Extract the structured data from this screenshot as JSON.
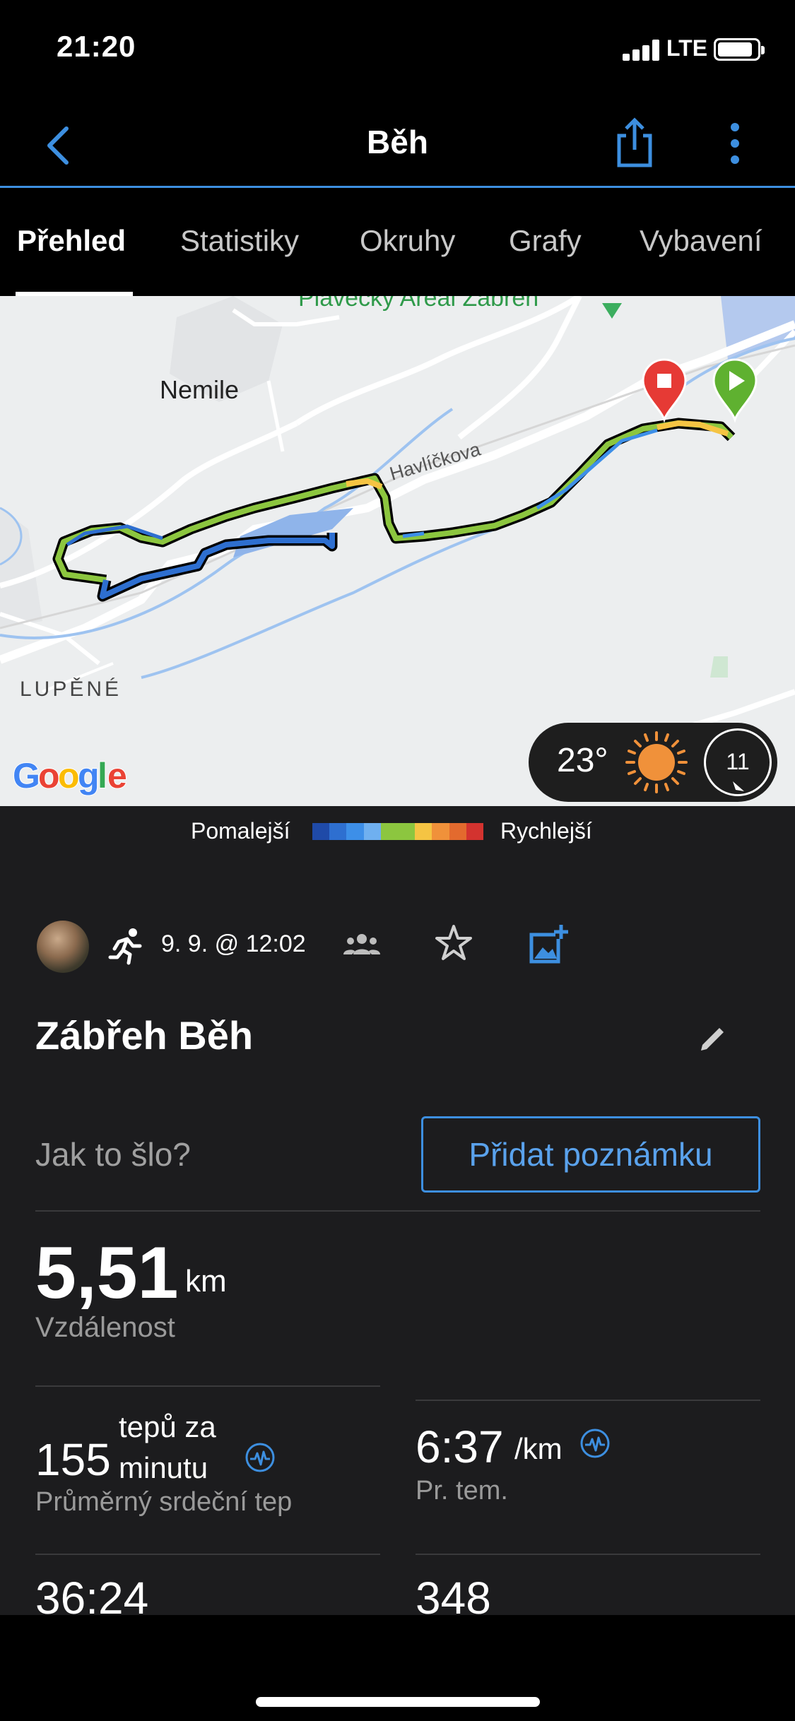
{
  "status_bar": {
    "time": "21:20",
    "network": "LTE"
  },
  "header": {
    "title": "Běh",
    "back_icon": "chevron-left-icon",
    "share_icon": "share-icon",
    "more_icon": "more-vertical-icon"
  },
  "tabs": [
    {
      "label": "Přehled",
      "active": true
    },
    {
      "label": "Statistiky"
    },
    {
      "label": "Okruhy"
    },
    {
      "label": "Grafy"
    },
    {
      "label": "Vybavení"
    }
  ],
  "map": {
    "labels": {
      "place_top": "Plavecký Areál Zábřeh",
      "village": "Nemile",
      "street": "Havlíčkova",
      "town": "LUPĚNÉ",
      "provider": "Google"
    },
    "weather": {
      "temperature": "23°",
      "condition_icon": "sun-icon",
      "wind_speed": "11"
    }
  },
  "legend": {
    "slower": "Pomalejší",
    "faster": "Rychlejší",
    "colors": [
      "#1f4aa8",
      "#2e6fd0",
      "#3d8fe8",
      "#6fb0f0",
      "#8cc63f",
      "#8cc63f",
      "#f5c443",
      "#f0913a",
      "#e36a2e",
      "#d3332f"
    ]
  },
  "activity": {
    "date": "9. 9. @ 12:02",
    "name": "Zábřeh Běh",
    "note_prompt": "Jak to šlo?",
    "add_note": "Přidat poznámku"
  },
  "stats": {
    "distance": {
      "value": "5,51",
      "unit": "km",
      "label": "Vzdálenost"
    },
    "heart_rate": {
      "value": "155",
      "unit_line1": "tepů za",
      "unit_line2": "minutu",
      "label": "Průměrný srdeční tep"
    },
    "pace": {
      "value": "6:37",
      "unit": "/km",
      "label": "Pr. tem."
    },
    "time": {
      "value": "36:24"
    },
    "calories": {
      "value": "348"
    }
  }
}
